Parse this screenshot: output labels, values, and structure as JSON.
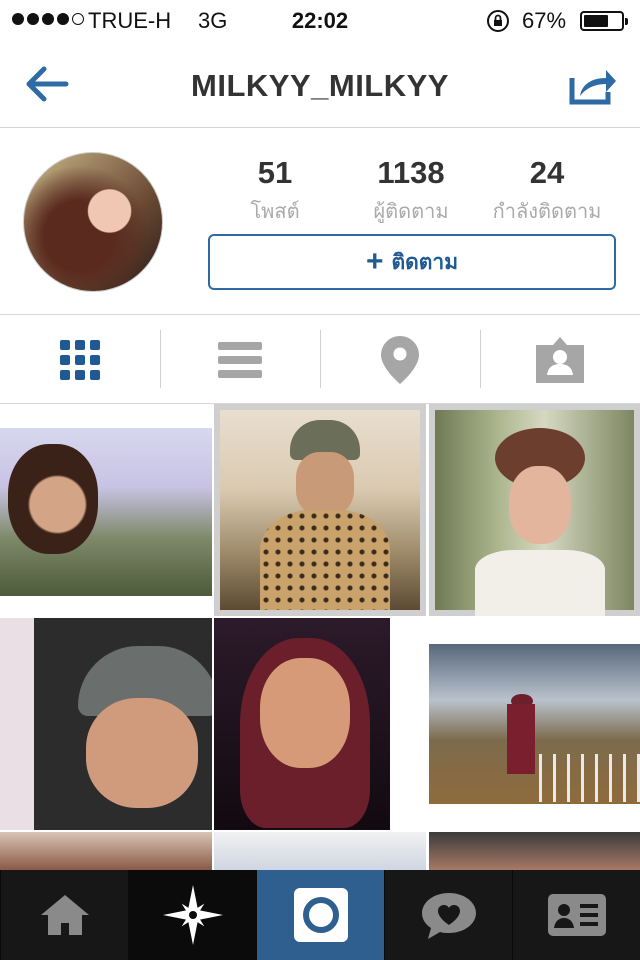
{
  "status_bar": {
    "carrier": "TRUE-H",
    "network": "3G",
    "time": "22:02",
    "battery_percent": "67%",
    "battery_level": 0.67
  },
  "nav": {
    "title": "MILKYY_MILKYY",
    "back_icon": "arrow-left-icon",
    "share_icon": "share-icon"
  },
  "profile": {
    "stats": [
      {
        "value": "51",
        "label": "โพสต์"
      },
      {
        "value": "1138",
        "label": "ผู้ติดตาม"
      },
      {
        "value": "24",
        "label": "กำลังติดตาม"
      }
    ],
    "follow_button": {
      "icon": "+",
      "label": "ติดตาม"
    }
  },
  "view_tabs": [
    {
      "icon": "grid-icon",
      "active": true
    },
    {
      "icon": "list-icon",
      "active": false
    },
    {
      "icon": "location-pin-icon",
      "active": false
    },
    {
      "icon": "tagged-person-icon",
      "active": false
    }
  ],
  "photos_count_visible": 9,
  "colors": {
    "accent": "#2e6aa3",
    "tabbar_bg": "#171717",
    "tabbar_active": "#2f5f8f"
  },
  "bottom_tabs": [
    {
      "icon": "home-icon",
      "active": false
    },
    {
      "icon": "explore-star-icon",
      "active": false
    },
    {
      "icon": "camera-icon",
      "active": true
    },
    {
      "icon": "activity-heart-icon",
      "active": false
    },
    {
      "icon": "profile-card-icon",
      "active": false
    }
  ]
}
